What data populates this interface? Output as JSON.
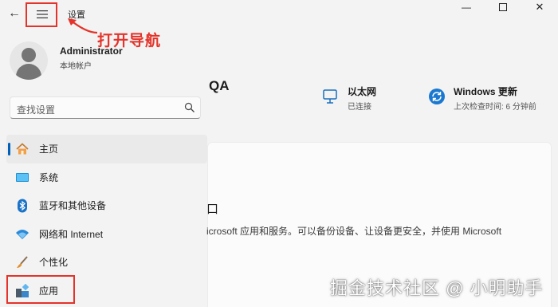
{
  "window": {
    "title": "设置",
    "back_icon": "arrow-left-icon",
    "menu_icon": "hamburger-icon",
    "controls": [
      "minimize-icon",
      "maximize-icon",
      "close-icon"
    ]
  },
  "annotation": {
    "text": "打开导航",
    "color": "#e4332a"
  },
  "profile": {
    "name": "Administrator",
    "account_type": "本地帐户"
  },
  "search": {
    "placeholder": "查找设置"
  },
  "nav": {
    "accent": "#005fb8",
    "items": [
      {
        "label": "主页",
        "icon": "home-icon",
        "active": true
      },
      {
        "label": "系统",
        "icon": "system-icon"
      },
      {
        "label": "蓝牙和其他设备",
        "icon": "bluetooth-icon"
      },
      {
        "label": "网络和 Internet",
        "icon": "wifi-icon"
      },
      {
        "label": "个性化",
        "icon": "brush-icon"
      },
      {
        "label": "应用",
        "icon": "apps-icon"
      }
    ]
  },
  "main": {
    "pc_name_fragment": "QA",
    "network": {
      "title": "以太网",
      "status": "已连接",
      "icon": "ethernet-icon"
    },
    "update": {
      "title": "Windows 更新",
      "status": "上次检查时间: 6 分钟前",
      "icon": "sync-icon"
    },
    "card": {
      "heading_fragment": "口",
      "desc_fragment": "icrosoft 应用和服务。可以备份设备、让设备更安全，并使用 Microsoft"
    }
  },
  "watermark": "掘金技术社区 @ 小明助手"
}
